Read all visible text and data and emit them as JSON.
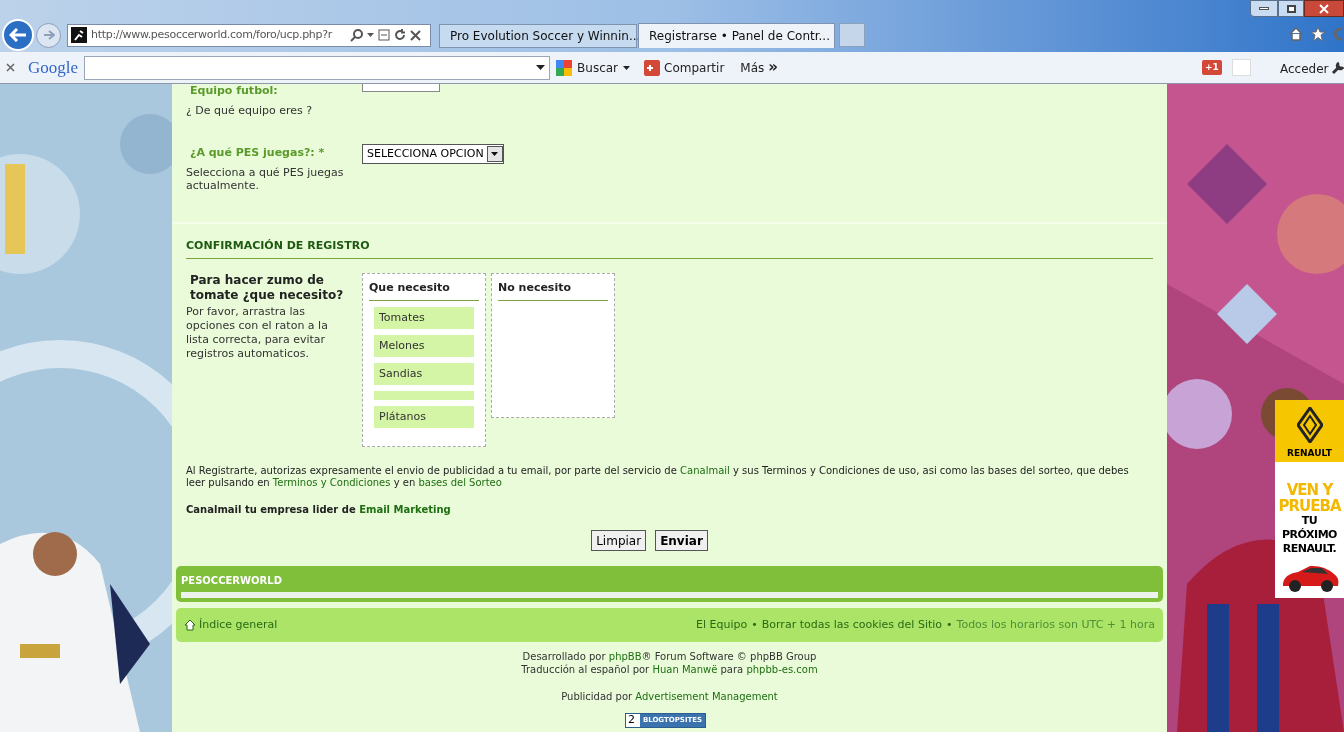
{
  "browser": {
    "address": "http://www.pesoccerworld.com/foro/ucp.php?r",
    "tabs": [
      {
        "label": "Pro Evolution Soccer y Winnin...",
        "selected": false
      },
      {
        "label": "Registrarse • Panel de Contr...",
        "selected": true
      }
    ]
  },
  "google_toolbar": {
    "logo": "Google",
    "search_button": "Buscar",
    "share_button": "Compartir",
    "more_button": "Más",
    "more_glyph": "»",
    "plus_one": "+1",
    "sign_in": "Acceder"
  },
  "form": {
    "fields": [
      {
        "kind": "text",
        "label": "Equipo futbol:",
        "description": "¿ De qué equipo eres ?"
      },
      {
        "kind": "select",
        "label": "¿A qué PES juegas?: *",
        "description": "Selecciona a qué PES juegas actualmente.",
        "value": "SELECCIONA OPCION"
      }
    ],
    "section_title": "CONFIRMACIÓN DE REGISTRO",
    "question": {
      "title": "Para hacer zumo de tomate ¿que necesito?",
      "description": "Por favor, arrastra las opciones con el raton a la lista correcta, para evitar registros automaticos."
    },
    "lists": [
      {
        "title": "Que necesito",
        "items": [
          {
            "kind": "item",
            "label": "Tomates"
          },
          {
            "kind": "item",
            "label": "Melones"
          },
          {
            "kind": "item",
            "label": "Sandias"
          },
          {
            "kind": "blank"
          },
          {
            "kind": "item",
            "label": "Plátanos"
          }
        ]
      },
      {
        "title": "No necesito"
      }
    ],
    "legal": [
      {
        "text": "Al Registrarte, autorizas expresamente el envio de publicidad a tu email, por parte del servicio de ",
        "link": false
      },
      {
        "text": "Canalmail",
        "link": true
      },
      {
        "text": " y sus Terminos y Condiciones de uso, asi como las bases del sorteo, que debes leer pulsando en ",
        "link": false
      },
      {
        "text": "Terminos y Condiciones",
        "link": true
      },
      {
        "text": " y en ",
        "link": false
      },
      {
        "text": "bases del Sorteo",
        "link": true
      }
    ],
    "promo": [
      {
        "text": "Canalmail tu empresa lider de ",
        "link": false
      },
      {
        "text": "Email Marketing",
        "link": true
      }
    ],
    "buttons": [
      {
        "label": "Limpiar",
        "primary": false
      },
      {
        "label": "Enviar",
        "primary": true
      }
    ]
  },
  "forum_bar": {
    "title": "PESOCCERWORLD"
  },
  "footer_nav": {
    "home": "Índice general",
    "links": [
      "El Equipo",
      "Borrar todas las cookies del Sitio"
    ],
    "separators": [
      "•",
      "•"
    ],
    "timezone": "Todos los horarios son UTC + 1 hora"
  },
  "credits": [
    [
      {
        "text": "Desarrollado por ",
        "link": false
      },
      {
        "text": "phpBB",
        "link": true
      },
      {
        "text": "® Forum Software © phpBB Group",
        "link": false
      }
    ],
    [
      {
        "text": "Traducción al español por ",
        "link": false
      },
      {
        "text": "Huan Manwë",
        "link": true
      },
      {
        "text": " para ",
        "link": false
      },
      {
        "text": "phpbb-es.com",
        "link": true
      }
    ],
    [
      {
        "text": "Publicidad por ",
        "link": false
      },
      {
        "text": "Advertisement Management",
        "link": true
      }
    ]
  ],
  "counter": {
    "count": "2",
    "label": "BLOGTOPSITES"
  },
  "ad": {
    "brand": "RENAULT",
    "headline": "VEN Y PRUEBA",
    "tagline": "TU PRÓXIMO RENAULT."
  }
}
